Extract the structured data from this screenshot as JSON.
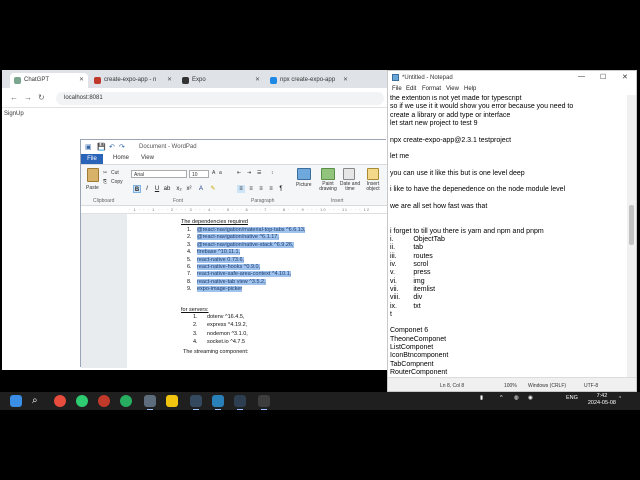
{
  "browser": {
    "tabs": [
      {
        "label": "ChatGPT",
        "color": "#7aa58f"
      },
      {
        "label": "create-expo-app - n",
        "color": "#c0392b"
      },
      {
        "label": "Expo",
        "color": "#333333"
      },
      {
        "label": "npx create-expo-app",
        "color": "#1e88e5"
      }
    ],
    "url": "localhost:8081",
    "page_text": "SignUp"
  },
  "wordpad": {
    "title": "Document - WordPad",
    "file_tab": "File",
    "tabs": [
      "Home",
      "View"
    ],
    "clipboard": {
      "paste": "Paste",
      "cut": "Cut",
      "copy": "Copy",
      "label": "Clipboard"
    },
    "font": {
      "name": "Arial",
      "size": "10",
      "label": "Font"
    },
    "paragraph_label": "Paragraph",
    "insert": {
      "picture": "Picture",
      "paint": "Paint drawing",
      "datetime": "Date and time",
      "object": "Insert object",
      "label": "Insert"
    },
    "ruler": "· 1 · · · 1 · · · 2 · · · 3 · · · 4 · · · 5 · · · 6 · · · 7 · · · 8 · · · 9 · · · 10 · · · 11 · · · 12",
    "doc": {
      "heading1": "The dependencies required",
      "deps": [
        {
          "n": "1.",
          "t": "@react-navigation/material-top-tabs ^6.6.13,"
        },
        {
          "n": "2.",
          "t": "@react-navigation/native ^6.1.17,"
        },
        {
          "n": "3.",
          "t": "@react-navigation/native-stack ^6.9.26,"
        },
        {
          "n": "4.",
          "t": "firebase ^10.11.1,"
        },
        {
          "n": "5.",
          "t": "react-native 0.73.6,"
        },
        {
          "n": "6.",
          "t": "react-native-hooks ^0.9.0,"
        },
        {
          "n": "7.",
          "t": "react-native-safe-area-context ^4.10.1,"
        },
        {
          "n": "8.",
          "t": "react-native-tab view ^3.5.2,"
        },
        {
          "n": "9.",
          "t": "expo-image-picker"
        }
      ],
      "heading2": "for servers:",
      "servers": [
        {
          "n": "1.",
          "t": "dotenv ^16.4.5,"
        },
        {
          "n": "2.",
          "t": "express ^4.19.2,"
        },
        {
          "n": "3.",
          "t": "nodemon ^3.1.0,"
        },
        {
          "n": "4.",
          "t": "socket.io ^4.7.5"
        }
      ],
      "heading3": "The streaming component:"
    }
  },
  "notepad": {
    "title": "*Untitled - Notepad",
    "menu": [
      "File",
      "Edit",
      "Format",
      "View",
      "Help"
    ],
    "lines": [
      "the extention is not yet made for typescript",
      "so if we use it it would show you error because you need to",
      "create a library or add type or interface",
      "let start new project to test 9",
      "",
      "npx create-expo-app@2.3.1 testproject",
      "",
      "let me",
      "",
      "you can use it like this but is one level deep",
      "",
      "i like to have the depenedence on the node module level",
      "",
      "we are all set how fast was that",
      "",
      "",
      "i forget to till you there is yarn and npm and pnpm",
      "i.\t\tObjectTab",
      "ii.\t\ttab",
      "iii.\t\troutes",
      "iv.\t\tscrol",
      "v.\t\tpress",
      "vi.\t\timg",
      "vii.\t\titemlist",
      "viii.\t\tdiv",
      "ix.\t\ttxt",
      "t",
      "",
      "Componet 6",
      "TheoneComponet",
      "ListComponet",
      "IconBtncomponent",
      "TabCompnent",
      "RouterComponent"
    ],
    "status": {
      "pos": "Ln 8, Col 8",
      "zoom": "100%",
      "eol": "Windows (CRLF)",
      "enc": "UTF-8"
    }
  },
  "taskbar": {
    "lang": "ENG",
    "time": "7:42",
    "date": "2024-05-08"
  }
}
